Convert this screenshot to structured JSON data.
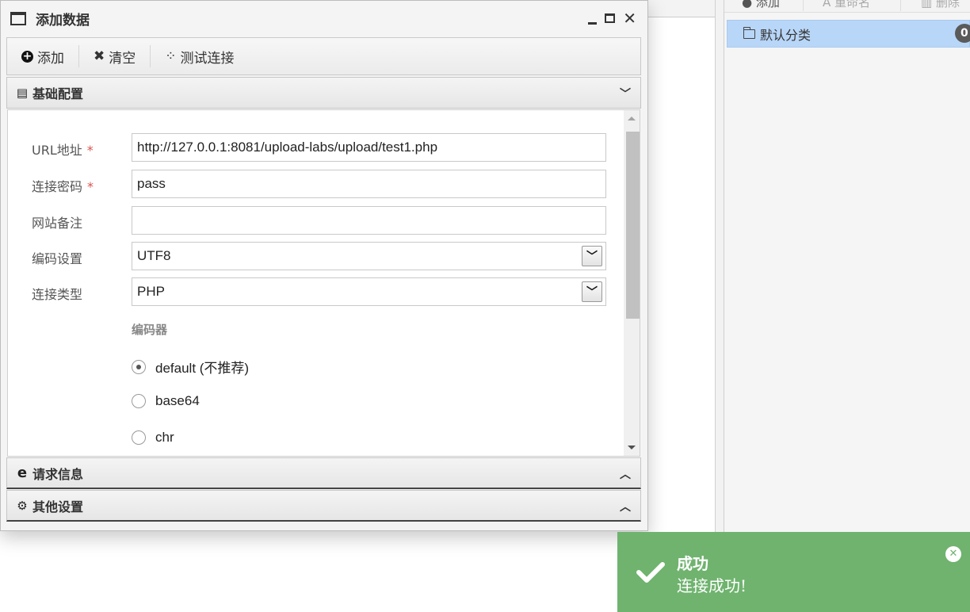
{
  "background": {
    "toolbar": {
      "add_label": "添加",
      "rename_label": "重命名",
      "delete_label": "删除"
    },
    "category": {
      "label": "默认分类",
      "count": "0"
    }
  },
  "dialog": {
    "title": "添加数据",
    "toolbar": {
      "add_label": "添加",
      "clear_label": "清空",
      "test_label": "测试连接"
    },
    "sections": {
      "basic": "基础配置",
      "request": "请求信息",
      "other": "其他设置"
    },
    "form": {
      "url": {
        "label": "URL地址",
        "required": "*",
        "value": "http://127.0.0.1:8081/upload-labs/upload/test1.php"
      },
      "password": {
        "label": "连接密码",
        "required": "*",
        "value": "pass"
      },
      "note": {
        "label": "网站备注",
        "value": ""
      },
      "encoding": {
        "label": "编码设置",
        "value": "UTF8"
      },
      "type": {
        "label": "连接类型",
        "value": "PHP"
      },
      "encoder": {
        "label": "编码器",
        "options": [
          {
            "label": "default (不推荐)",
            "selected": true
          },
          {
            "label": "base64",
            "selected": false
          },
          {
            "label": "chr",
            "selected": false
          }
        ]
      }
    }
  },
  "toast": {
    "title": "成功",
    "message": "连接成功!",
    "color": "#6fb36e"
  }
}
